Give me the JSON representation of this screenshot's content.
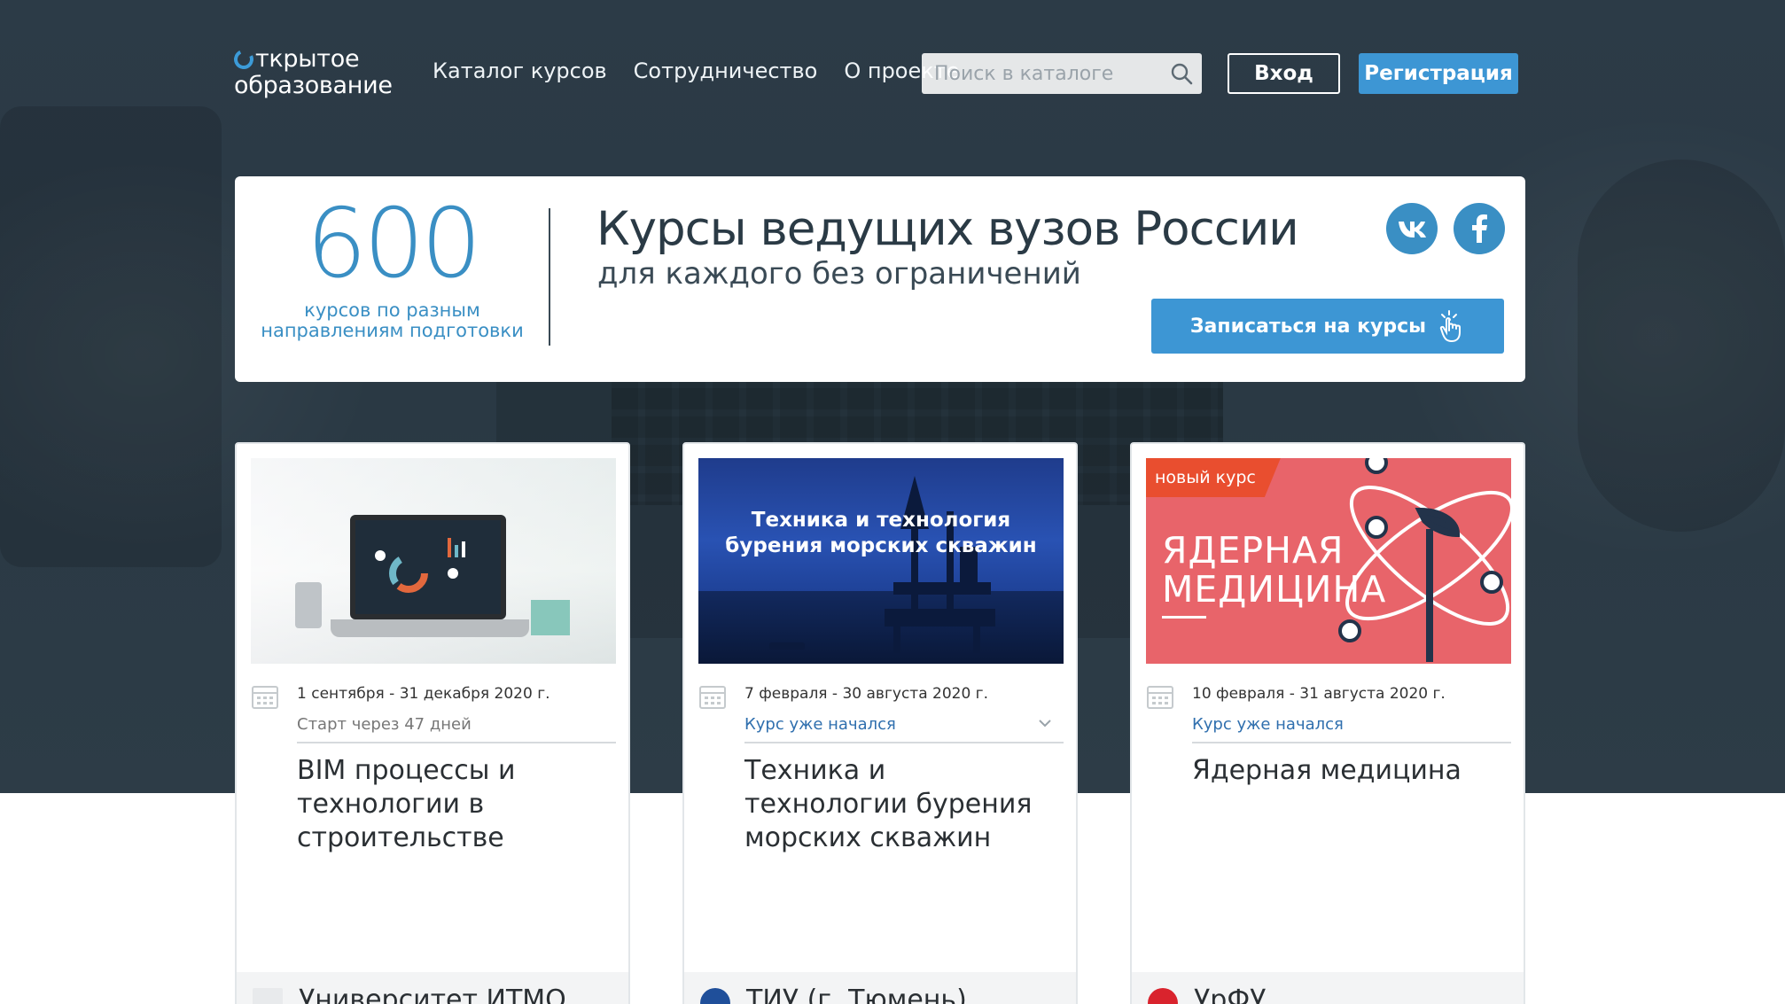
{
  "header": {
    "logo_line1": "ткрытое",
    "logo_line2": "образование",
    "nav": [
      "Каталог курсов",
      "Сотрудничество",
      "О проекте"
    ],
    "search_placeholder": "Поиск в каталоге",
    "login_label": "Вход",
    "register_label": "Регистрация"
  },
  "banner": {
    "count": "600",
    "count_desc_line1": "курсов по разным",
    "count_desc_line2": "направлениям подготовки",
    "headline": "Курсы ведущих вузов России",
    "subheadline": "для каждого без ограничений",
    "cta_label": "Записаться на курсы",
    "social": [
      "vk-icon",
      "facebook-icon"
    ]
  },
  "cards": [
    {
      "dates": "1 сентября - 31 декабря 2020 г.",
      "status": "Старт через 47 дней",
      "title": "BIM процессы и технологии в строительстве",
      "university": "Университет ИТМО"
    },
    {
      "dates": "7 февраля - 30 августа 2020 г.",
      "status": "Курс уже начался",
      "title": "Техника и технологии бурения морских скважин",
      "university": "ТИУ (г. Тюмень)",
      "thumb_text_line1": "Техника и технология",
      "thumb_text_line2": "бурения морских скважин"
    },
    {
      "dates": "10 февраля - 31 августа 2020 г.",
      "status": "Курс уже начался",
      "title": "Ядерная медицина",
      "university": "УрФУ",
      "badge": "новый курс",
      "thumb_text_line1": "ЯДЕРНАЯ",
      "thumb_text_line2": "МЕДИЦИНА"
    }
  ],
  "colors": {
    "hero_bg": "#2c3b47",
    "accent": "#3d96d4",
    "badge": "#e94e2f",
    "thumb3_bg": "#e8646a"
  }
}
